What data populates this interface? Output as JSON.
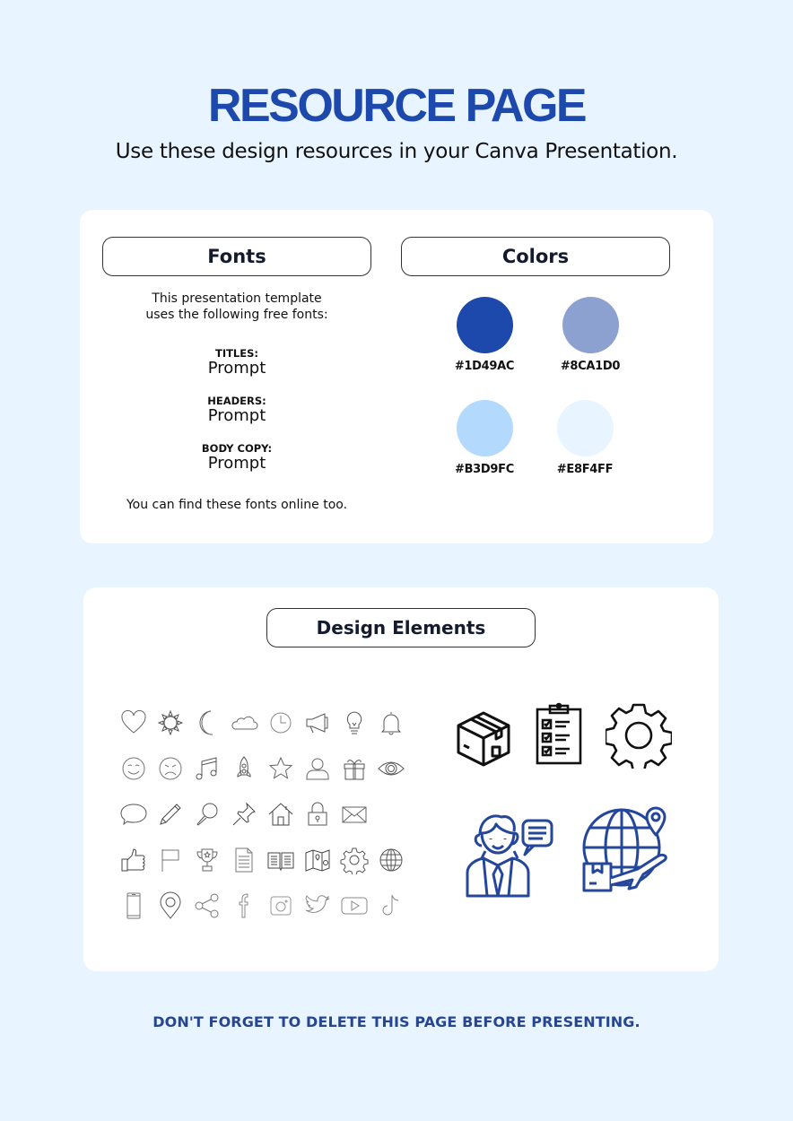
{
  "header": {
    "title": "RESOURCE PAGE",
    "subtitle": "Use these design resources in your Canva Presentation."
  },
  "fonts": {
    "heading": "Fonts",
    "intro_line1": "This presentation template",
    "intro_line2": "uses the following free fonts:",
    "items": [
      {
        "label": "TITLES:",
        "font": "Prompt"
      },
      {
        "label": "HEADERS:",
        "font": "Prompt"
      },
      {
        "label": "BODY COPY:",
        "font": "Prompt"
      }
    ],
    "footer": "You can find these fonts online too."
  },
  "colors": {
    "heading": "Colors",
    "swatches": [
      {
        "hex": "#1D49AC",
        "label": "#1D49AC"
      },
      {
        "hex": "#8CA1D0",
        "label": "#8CA1D0"
      },
      {
        "hex": "#B3D9FC",
        "label": "#B3D9FC"
      },
      {
        "hex": "#E8F4FF",
        "label": "#E8F4FF"
      }
    ]
  },
  "design_elements": {
    "heading": "Design Elements",
    "line_icons": [
      [
        "heart-icon",
        "sun-icon",
        "moon-icon",
        "cloud-icon",
        "clock-icon",
        "megaphone-icon",
        "lightbulb-icon",
        "bell-icon"
      ],
      [
        "smile-icon",
        "sad-icon",
        "music-note-icon",
        "rocket-icon",
        "star-icon",
        "user-icon",
        "gift-icon",
        "eye-icon"
      ],
      [
        "speech-bubble-icon",
        "pencil-icon",
        "magnifier-icon",
        "pushpin-icon",
        "home-icon",
        "padlock-icon",
        "envelope-icon"
      ],
      [
        "thumbs-up-icon",
        "flag-icon",
        "trophy-icon",
        "document-icon",
        "open-book-icon",
        "map-icon",
        "gear-icon",
        "globe-icon"
      ],
      [
        "smartphone-icon",
        "location-pin-icon",
        "share-icon",
        "facebook-icon",
        "instagram-icon",
        "twitter-icon",
        "youtube-icon",
        "tiktok-icon"
      ]
    ],
    "featured_icons": [
      "package-box-icon",
      "checklist-clipboard-icon",
      "settings-gear-icon",
      "customer-support-agent-icon",
      "global-shipping-icon"
    ]
  },
  "footer": {
    "note": "DON'T FORGET TO DELETE THIS PAGE BEFORE PRESENTING."
  }
}
